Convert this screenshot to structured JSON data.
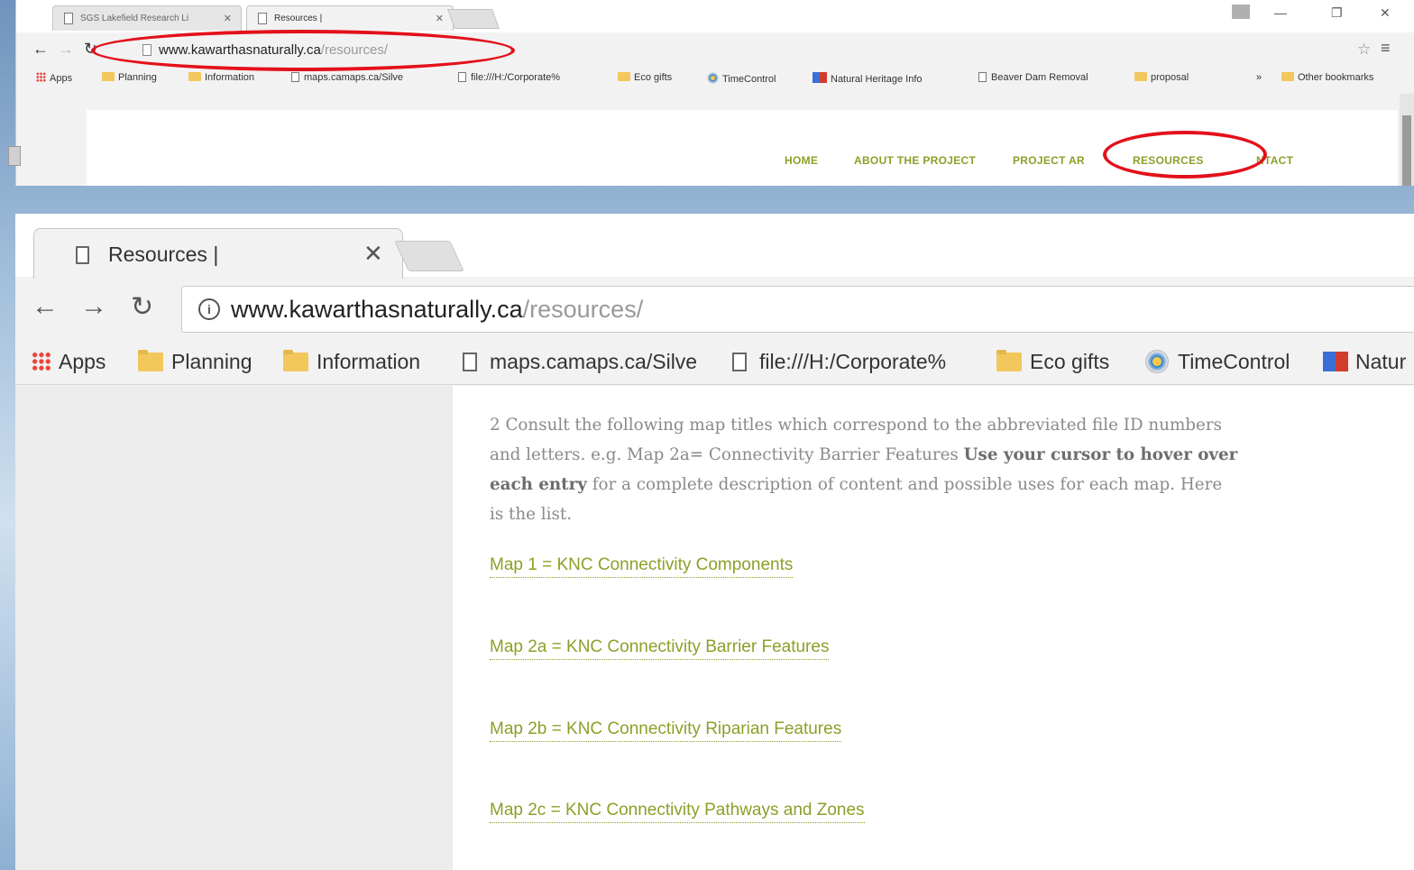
{
  "top_window": {
    "tabs": [
      {
        "label": "SGS Lakefield Research Li"
      },
      {
        "label": "Resources |"
      }
    ],
    "address": {
      "domain": "www.kawarthasnaturally.ca",
      "path": "/resources/"
    },
    "bookmarks": [
      {
        "label": "Apps"
      },
      {
        "label": "Planning"
      },
      {
        "label": "Information"
      },
      {
        "label": "maps.camaps.ca/Silve"
      },
      {
        "label": "file:///H:/Corporate%"
      },
      {
        "label": "Eco gifts"
      },
      {
        "label": "TimeControl"
      },
      {
        "label": "Natural Heritage Info"
      },
      {
        "label": "Beaver Dam Removal"
      },
      {
        "label": "proposal"
      },
      {
        "label": "»"
      },
      {
        "label": "Other bookmarks"
      }
    ],
    "site_nav": [
      {
        "label": "HOME"
      },
      {
        "label": "ABOUT THE PROJECT"
      },
      {
        "label": "PROJECT AR"
      },
      {
        "label": "RESOURCES"
      },
      {
        "label": "NTACT"
      }
    ]
  },
  "bottom_window": {
    "tab": {
      "label": "Resources |"
    },
    "address": {
      "domain": "www.kawarthasnaturally.ca",
      "path": "/resources/"
    },
    "bookmarks": [
      {
        "label": "Apps"
      },
      {
        "label": "Planning"
      },
      {
        "label": "Information"
      },
      {
        "label": "maps.camaps.ca/Silve"
      },
      {
        "label": "file:///H:/Corporate%"
      },
      {
        "label": "Eco gifts"
      },
      {
        "label": "TimeControl"
      },
      {
        "label": "Natur"
      }
    ],
    "content": {
      "para_part1": "2 Consult the following map titles which correspond to the abbreviated file ID numbers and letters. e.g. Map 2a= Connectivity Barrier Features ",
      "para_bold": "Use your cursor to hover over each entry",
      "para_part2": " for a complete description of content and possible uses for each map. Here is the list.",
      "map_links": [
        {
          "label": "Map 1 = KNC Connectivity Components"
        },
        {
          "label": "Map 2a = KNC Connectivity Barrier Features"
        },
        {
          "label": "Map 2b = KNC Connectivity Riparian Features"
        },
        {
          "label": "Map 2c = KNC Connectivity Pathways and Zones"
        }
      ]
    }
  },
  "colors": {
    "annotation_oval": "#e3101a",
    "link_green": "#8aa129"
  }
}
